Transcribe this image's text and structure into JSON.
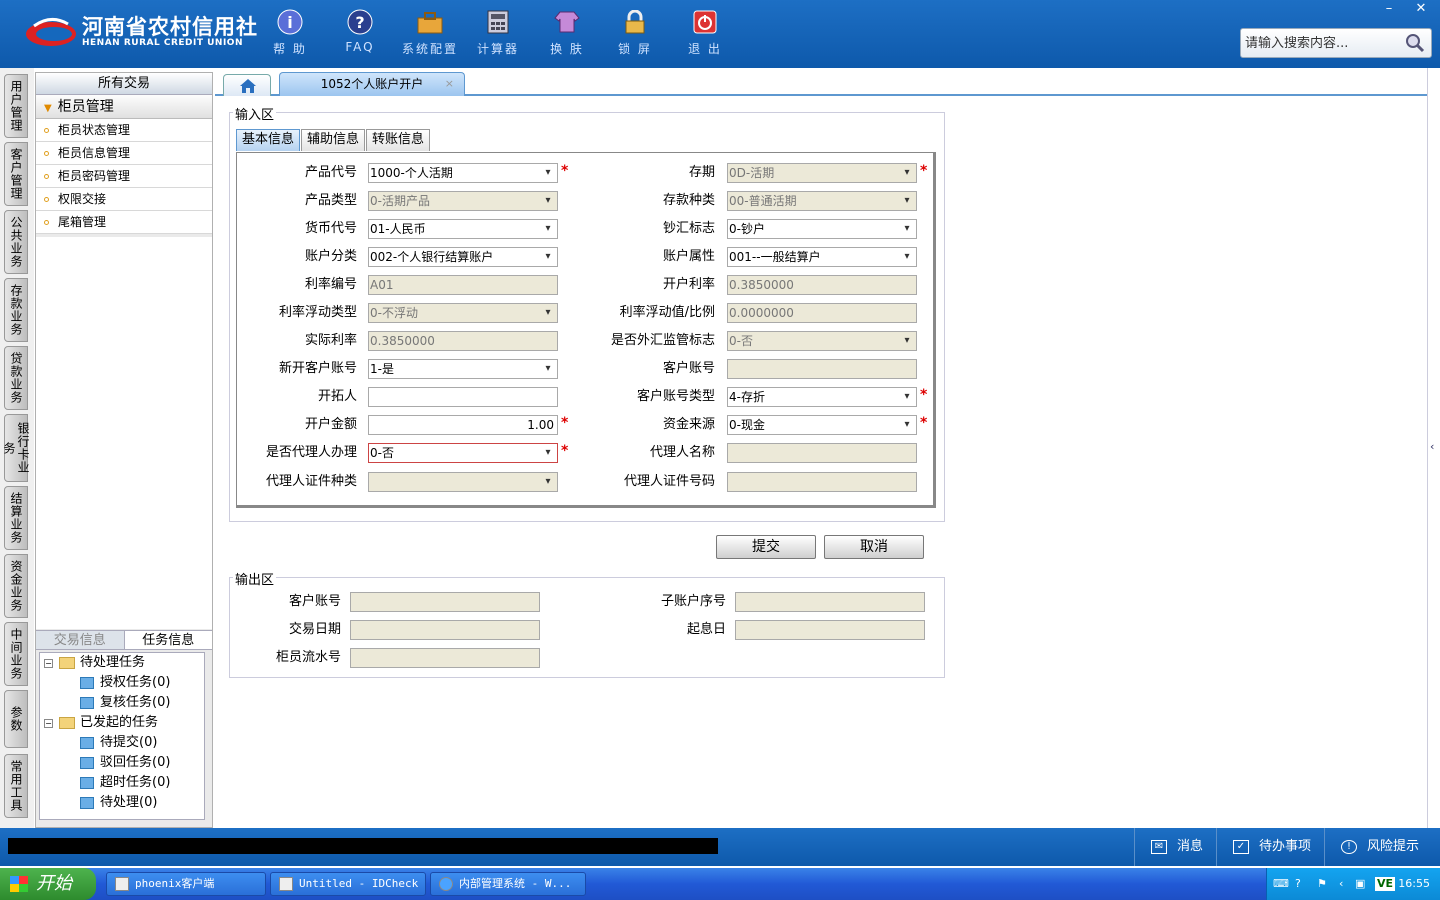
{
  "brand": {
    "name_cn": "河南省农村信用社",
    "name_en": "HENAN RURAL CREDIT UNION"
  },
  "toolbar": [
    {
      "label": "帮 助",
      "icon": "info-icon"
    },
    {
      "label": "FAQ",
      "icon": "question-icon"
    },
    {
      "label": "系统配置",
      "icon": "toolbox-icon"
    },
    {
      "label": "计算器",
      "icon": "calculator-icon"
    },
    {
      "label": "换 肤",
      "icon": "shirt-icon"
    },
    {
      "label": "锁 屏",
      "icon": "lock-icon"
    },
    {
      "label": "退 出",
      "icon": "power-icon"
    }
  ],
  "window_controls": {
    "minimize": "–",
    "close": "✕"
  },
  "search": {
    "placeholder": "请输入搜索内容..."
  },
  "vertical_tabs": [
    "用户管理",
    "客户管理",
    "公共业务",
    "存款业务",
    "贷款业务",
    "银行卡业务",
    "结算业务",
    "资金业务",
    "中间业务",
    "参数",
    "常用工具"
  ],
  "left_panel": {
    "header": "所有交易",
    "group": "柜员管理",
    "items": [
      "柜员状态管理",
      "柜员信息管理",
      "柜员密码管理",
      "权限交接",
      "尾箱管理"
    ],
    "tabs": [
      "交易信息",
      "任务信息"
    ],
    "tree": {
      "pending": {
        "label": "待处理任务",
        "children": [
          "授权任务(0)",
          "复核任务(0)"
        ]
      },
      "initiated": {
        "label": "已发起的任务",
        "children": [
          "待提交(0)",
          "驳回任务(0)",
          "超时任务(0)",
          "待处理(0)"
        ]
      }
    }
  },
  "tabs": {
    "active": "1052个人账户开户",
    "close": "×"
  },
  "input_area": {
    "legend": "输入区",
    "subtabs": [
      "基本信息",
      "辅助信息",
      "转账信息"
    ],
    "left_fields": [
      {
        "label": "产品代号",
        "value": "1000-个人活期"
      },
      {
        "label": "产品类型",
        "value": "0-活期产品"
      },
      {
        "label": "货币代号",
        "value": "01-人民币"
      },
      {
        "label": "账户分类",
        "value": "002-个人银行结算账户"
      },
      {
        "label": "利率编号",
        "value": "A01"
      },
      {
        "label": "利率浮动类型",
        "value": "0-不浮动"
      },
      {
        "label": "实际利率",
        "value": "0.3850000"
      },
      {
        "label": "新开客户账号",
        "value": "1-是"
      },
      {
        "label": "开拓人",
        "value": ""
      },
      {
        "label": "开户金额",
        "value": "1.00"
      },
      {
        "label": "是否代理人办理",
        "value": "0-否"
      },
      {
        "label": "代理人证件种类",
        "value": ""
      }
    ],
    "right_fields": [
      {
        "label": "存期",
        "value": "0D-活期"
      },
      {
        "label": "存款种类",
        "value": "00-普通活期"
      },
      {
        "label": "钞汇标志",
        "value": "0-钞户"
      },
      {
        "label": "账户属性",
        "value": "001--一般结算户"
      },
      {
        "label": "开户利率",
        "value": "0.3850000"
      },
      {
        "label": "利率浮动值/比例",
        "value": "0.0000000"
      },
      {
        "label": "是否外汇监管标志",
        "value": "0-否"
      },
      {
        "label": "客户账号",
        "value": ""
      },
      {
        "label": "客户账号类型",
        "value": "4-存折"
      },
      {
        "label": "资金来源",
        "value": "0-现金"
      },
      {
        "label": "代理人名称",
        "value": ""
      },
      {
        "label": "代理人证件号码",
        "value": ""
      }
    ],
    "required_mark": "*"
  },
  "buttons": {
    "submit": "提交",
    "cancel": "取消"
  },
  "output_area": {
    "legend": "输出区",
    "fields": [
      {
        "label": "客户账号",
        "value": ""
      },
      {
        "label": "子账户序号",
        "value": ""
      },
      {
        "label": "交易日期",
        "value": ""
      },
      {
        "label": "起息日",
        "value": ""
      },
      {
        "label": "柜员流水号",
        "value": ""
      }
    ]
  },
  "statusbar": {
    "messages": "消息",
    "todo": "待办事项",
    "risk": "风险提示"
  },
  "taskbar": {
    "start": "开始",
    "tasks": [
      "phoenix客户端",
      "Untitled - IDCheck",
      "内部管理系统 - W..."
    ],
    "tray_label": "VE",
    "clock": "16:55"
  },
  "colors": {
    "header_blue": "#1568bd",
    "required_red": "#dd0000",
    "readonly_bg": "#ece9d8"
  }
}
